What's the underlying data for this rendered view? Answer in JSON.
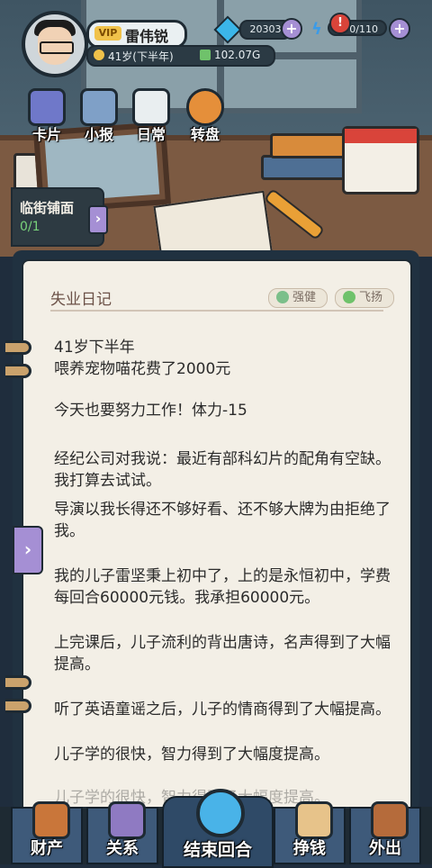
{
  "player": {
    "vip": "VIP",
    "name": "雷伟锐",
    "age": "41岁(下半年)",
    "cash": "102.07G"
  },
  "resources": {
    "gems": "20303",
    "energy": "0/110",
    "alert": "!"
  },
  "quick_menu": [
    {
      "label": "卡片",
      "icon": "cards-icon"
    },
    {
      "label": "小报",
      "icon": "newspaper-icon"
    },
    {
      "label": "日常",
      "icon": "clipboard-icon"
    },
    {
      "label": "转盘",
      "icon": "wheel-icon"
    }
  ],
  "event_card": {
    "title": "临街铺面",
    "progress": "0/1"
  },
  "diary": {
    "title": "失业日记",
    "tags": [
      {
        "label": "强健",
        "color": "#7bbf8a"
      },
      {
        "label": "飞扬",
        "color": "#6fc26b"
      }
    ],
    "entries": [
      "41岁下半年",
      "喂养宠物喵花费了2000元",
      "今天也要努力工作！体力-15",
      "经纪公司对我说：最近有部科幻片的配角有空缺。我打算去试试。",
      "导演以我长得还不够好看、还不够大牌为由拒绝了我。",
      "我的儿子雷坚秉上初中了，上的是永恒初中，学费每回合60000元钱。我承担60000元。",
      "上完课后，儿子流利的背出唐诗，名声得到了大幅提高。",
      "听了英语童谣之后，儿子的情商得到了大幅提高。",
      "儿子学的很快，智力得到了大幅度提高。",
      "儿子学的很快，智力得到了大幅度提高。"
    ]
  },
  "nav": {
    "assets": "财产",
    "relations": "关系",
    "end_turn": "结束回合",
    "earn": "挣钱",
    "go_out": "外出"
  },
  "colors": {
    "accent_purple": "#a58fd4",
    "paper": "#f3efe6",
    "nav_blue": "#3e5a7a"
  }
}
